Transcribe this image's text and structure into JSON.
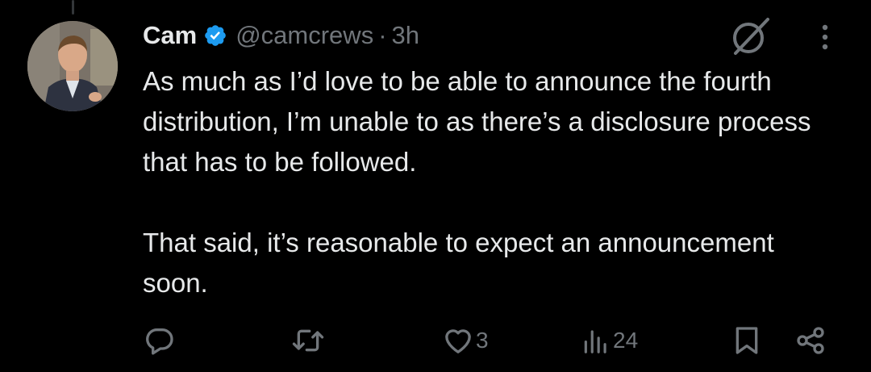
{
  "tweet": {
    "author": {
      "display_name": "Cam",
      "handle": "@camcrews",
      "verified": true,
      "avatar_icon": "profile-photo"
    },
    "separator": "·",
    "timestamp": "3h",
    "text": [
      "As much as I’d love to be able to announce the fourth distribution, I’m unable to as there’s a disclosure process that has to be followed.",
      "That said, it’s reasonable to expect an announcement soon."
    ],
    "actions": {
      "reply": {
        "icon": "reply-icon",
        "count": ""
      },
      "retweet": {
        "icon": "retweet-icon",
        "count": ""
      },
      "like": {
        "icon": "heart-icon",
        "count": "3"
      },
      "views": {
        "icon": "views-icon",
        "count": "24"
      },
      "bookmark": {
        "icon": "bookmark-icon"
      },
      "share": {
        "icon": "share-icon"
      }
    },
    "header_icons": [
      "grok-icon",
      "more-icon"
    ]
  },
  "colors": {
    "background": "#000000",
    "text_primary": "#e7e9ea",
    "text_secondary": "#71767b",
    "verified_badge": "#1d9bf0"
  }
}
